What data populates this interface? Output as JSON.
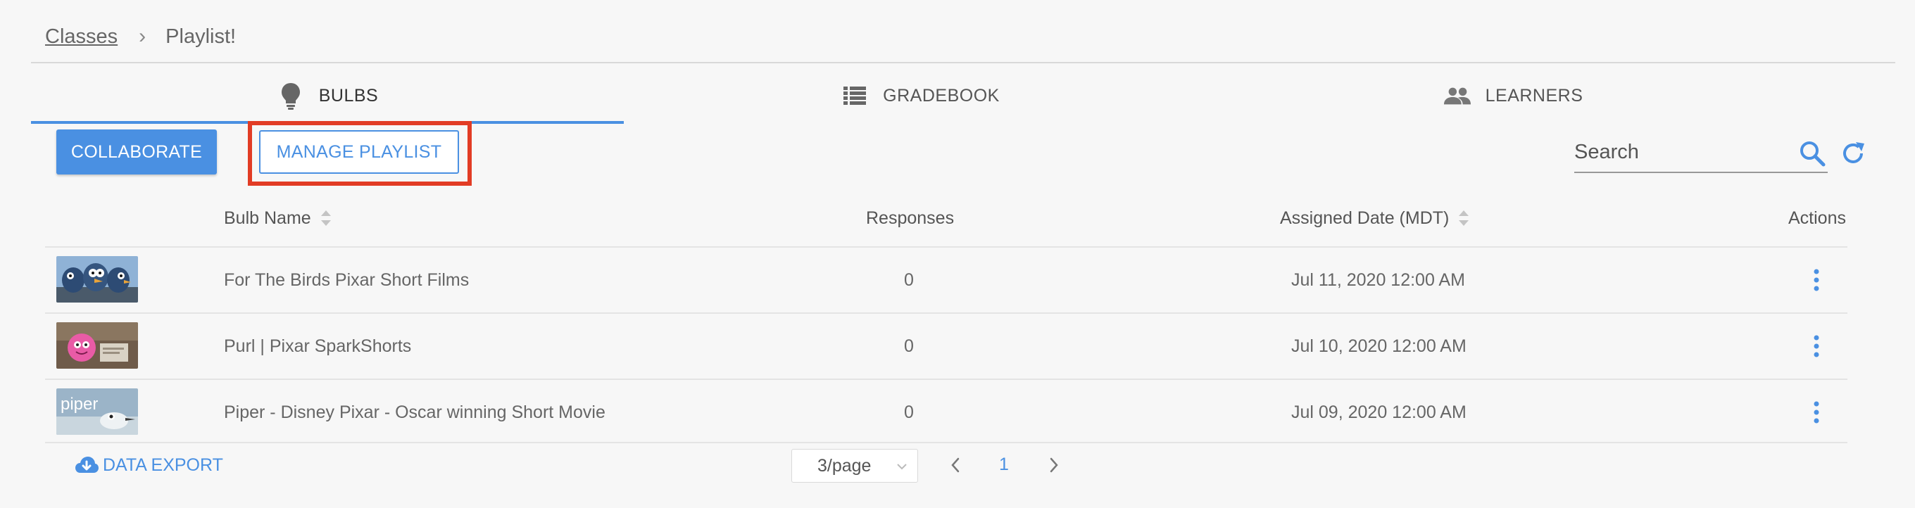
{
  "breadcrumb": {
    "root": "Classes",
    "separator": "›",
    "current": "Playlist!"
  },
  "tabs": [
    {
      "label": "BULBS",
      "icon": "bulb-icon",
      "active": true
    },
    {
      "label": "GRADEBOOK",
      "icon": "gradebook-icon",
      "active": false
    },
    {
      "label": "LEARNERS",
      "icon": "people-icon",
      "active": false
    }
  ],
  "toolbar": {
    "collaborate_label": "COLLABORATE",
    "manage_playlist_label": "MANAGE PLAYLIST",
    "search_placeholder": "Search"
  },
  "table": {
    "columns": [
      "Bulb Name",
      "Responses",
      "Assigned Date (MDT)",
      "Actions"
    ],
    "rows": [
      {
        "name": "For The Birds Pixar Short Films",
        "responses": "0",
        "date": "Jul 11, 2020 12:00 AM",
        "thumb": "birds"
      },
      {
        "name": "Purl | Pixar SparkShorts",
        "responses": "0",
        "date": "Jul 10, 2020 12:00 AM",
        "thumb": "purl"
      },
      {
        "name": "Piper - Disney Pixar -  Oscar winning  Short Movie",
        "responses": "0",
        "date": "Jul 09, 2020 12:00 AM",
        "thumb": "piper"
      }
    ]
  },
  "thumb_texts": {
    "piper": "piper"
  },
  "footer": {
    "data_export_label": "DATA EXPORT",
    "page_size": "3/page",
    "current_page": "1"
  },
  "colors": {
    "accent": "#4a90e2",
    "highlight": "#e23c25"
  }
}
